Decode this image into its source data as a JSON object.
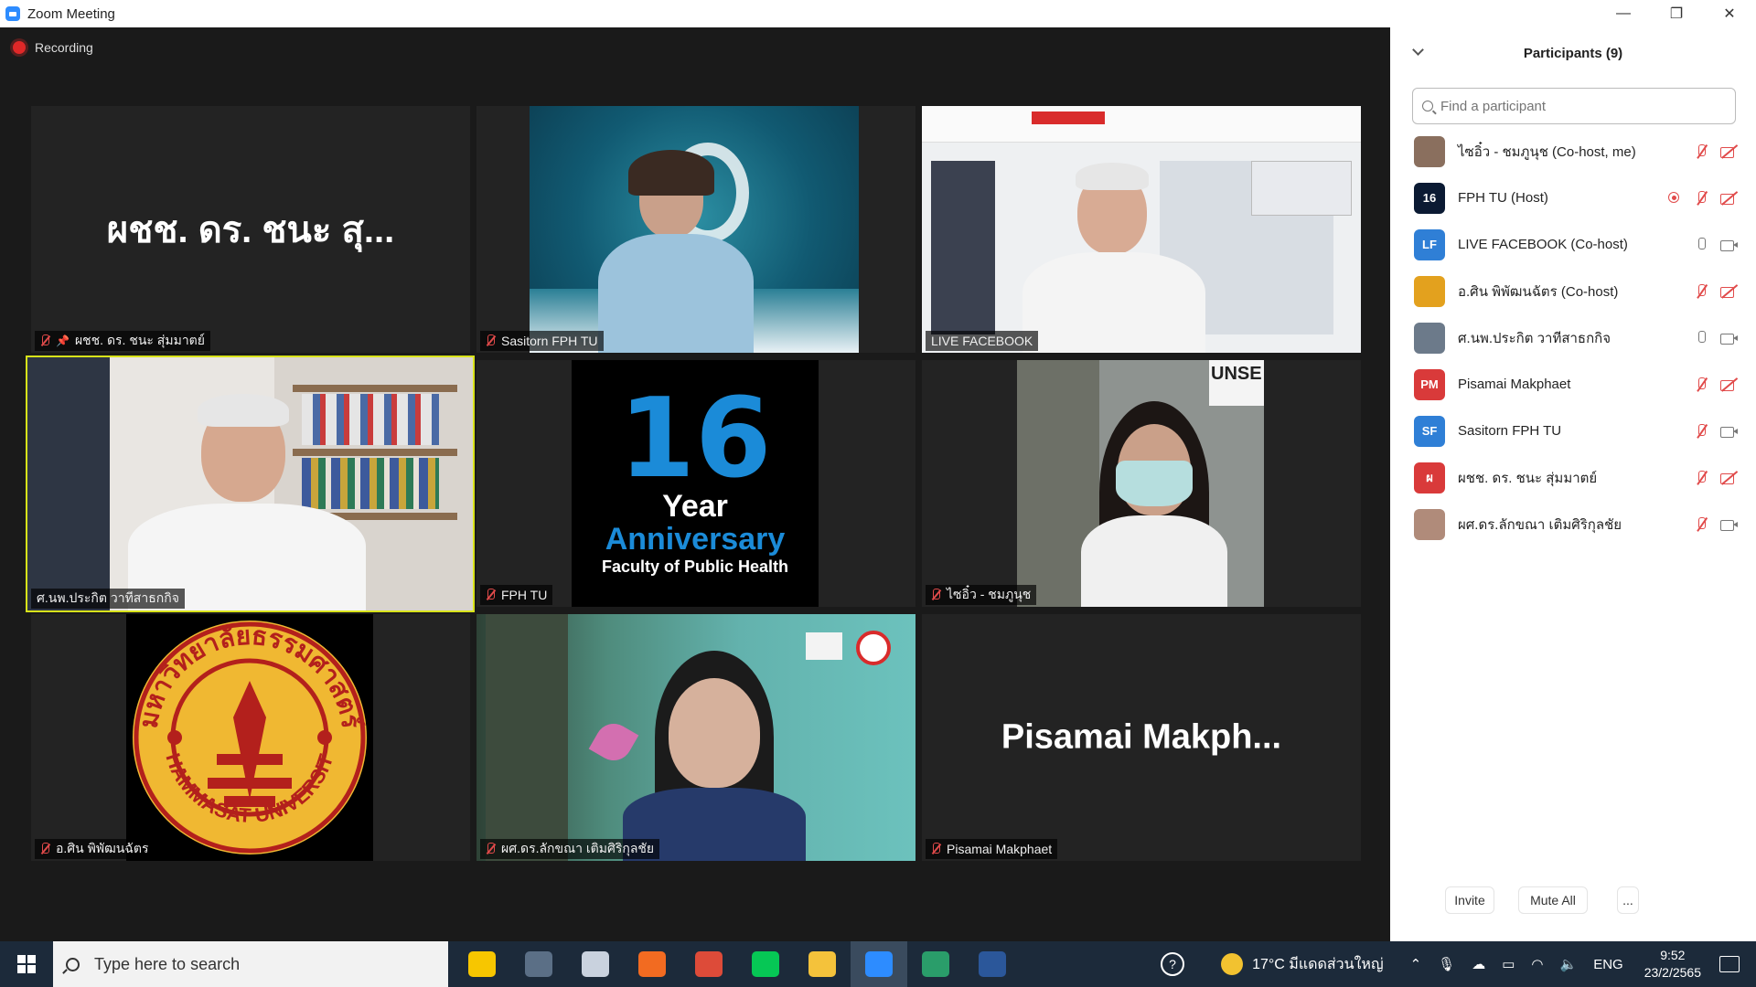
{
  "window": {
    "title": "Zoom Meeting",
    "controls": [
      "—",
      "❐",
      "✕"
    ]
  },
  "recording": {
    "label": "Recording"
  },
  "tiles": [
    {
      "name": "ผชช. ดร. ชนะ สุ่มมาตย์",
      "display_name": "ผชช. ดร. ชนะ สุ...",
      "muted": true,
      "pinned": true
    },
    {
      "name": "Sasitorn FPH TU",
      "muted": true
    },
    {
      "name": "LIVE FACEBOOK",
      "muted": false
    },
    {
      "name": "ศ.นพ.ประกิต  วาทีสาธกกิจ",
      "muted": false,
      "active_speaker": true
    },
    {
      "name": "FPH TU",
      "muted": true,
      "logo": {
        "number": "16",
        "line1": "Year",
        "line2": "Anniversary",
        "line3": "Faculty of Public Health"
      }
    },
    {
      "name": "ไซอิ๋ว - ชมภูนุช",
      "muted": true,
      "sign_text": "UNSE"
    },
    {
      "name": "อ.ศิน พิพัฒนฉัตร",
      "muted": true,
      "seal": {
        "thai": "มหาวิทยาลัยธรรมศาสตร์",
        "english": "THAMMASAT UNIVERSITY"
      }
    },
    {
      "name": "ผศ.ดร.ลักขณา เติมศิริกุลชัย",
      "muted": true
    },
    {
      "name": "Pisamai Makphaet",
      "display_name": "Pisamai  Makph...",
      "muted": true
    }
  ],
  "participants_panel": {
    "title": "Participants (9)",
    "search_placeholder": "Find a participant",
    "participants": [
      {
        "name": "ไซอิ๋ว - ชมภูนุช (Co-host, me)",
        "avatar": "",
        "avatar_color": "#8a6f5e",
        "mic": "off",
        "cam": "off",
        "recording": false
      },
      {
        "name": "FPH TU (Host)",
        "avatar": "16",
        "avatar_color": "#0b1a33",
        "mic": "off",
        "cam": "off",
        "recording": true
      },
      {
        "name": "LIVE FACEBOOK (Co-host)",
        "avatar": "LF",
        "avatar_color": "#2f7fd6",
        "mic": "on",
        "cam": "on",
        "recording": false
      },
      {
        "name": "อ.ศิน พิพัฒนฉัตร (Co-host)",
        "avatar": "",
        "avatar_color": "#e3a11e",
        "mic": "off",
        "cam": "off",
        "recording": false
      },
      {
        "name": "ศ.นพ.ประกิต  วาทีสาธกกิจ",
        "avatar": "",
        "avatar_color": "#6c7a8a",
        "mic": "on",
        "cam": "on",
        "recording": false
      },
      {
        "name": "Pisamai Makphaet",
        "avatar": "PM",
        "avatar_color": "#d93a3a",
        "mic": "off",
        "cam": "off",
        "recording": false
      },
      {
        "name": "Sasitorn FPH TU",
        "avatar": "SF",
        "avatar_color": "#2f7fd6",
        "mic": "off",
        "cam": "on",
        "recording": false
      },
      {
        "name": "ผชช. ดร. ชนะ สุ่มมาตย์",
        "avatar": "ผ",
        "avatar_color": "#d93a3a",
        "mic": "off",
        "cam": "off",
        "recording": false
      },
      {
        "name": "ผศ.ดร.ลักขณา เติมศิริกุลชัย",
        "avatar": "",
        "avatar_color": "#b08b7a",
        "mic": "off",
        "cam": "on",
        "recording": false
      }
    ],
    "footer": {
      "invite": "Invite",
      "mute_all": "Mute All",
      "more": "..."
    }
  },
  "taskbar": {
    "search_placeholder": "Type here to search",
    "apps": [
      {
        "icon": "sticky-notes-icon",
        "color": "#f7c600",
        "active": false
      },
      {
        "icon": "calculator-icon",
        "color": "#5b6f86",
        "active": false
      },
      {
        "icon": "paint-icon",
        "color": "#c9d2de",
        "active": false
      },
      {
        "icon": "app-orange-icon",
        "color": "#f26b21",
        "active": false
      },
      {
        "icon": "chrome-icon",
        "color": "#dd4b39",
        "active": false
      },
      {
        "icon": "line-icon",
        "color": "#06c755",
        "active": false
      },
      {
        "icon": "file-explorer-icon",
        "color": "#f4c23b",
        "active": false
      },
      {
        "icon": "zoom-icon",
        "color": "#2d8cff",
        "active": true
      },
      {
        "icon": "browser-green-icon",
        "color": "#2a9d6a",
        "active": false
      },
      {
        "icon": "word-icon",
        "color": "#2b579a",
        "active": false
      }
    ],
    "weather": "17°C  มีแดดส่วนใหญ่",
    "language": "ENG",
    "time": "9:52",
    "date": "23/2/2565",
    "colors": {
      "accent": "#2d8cff",
      "active_speaker": "#d8e31a",
      "muted": "#e14a4a"
    }
  }
}
